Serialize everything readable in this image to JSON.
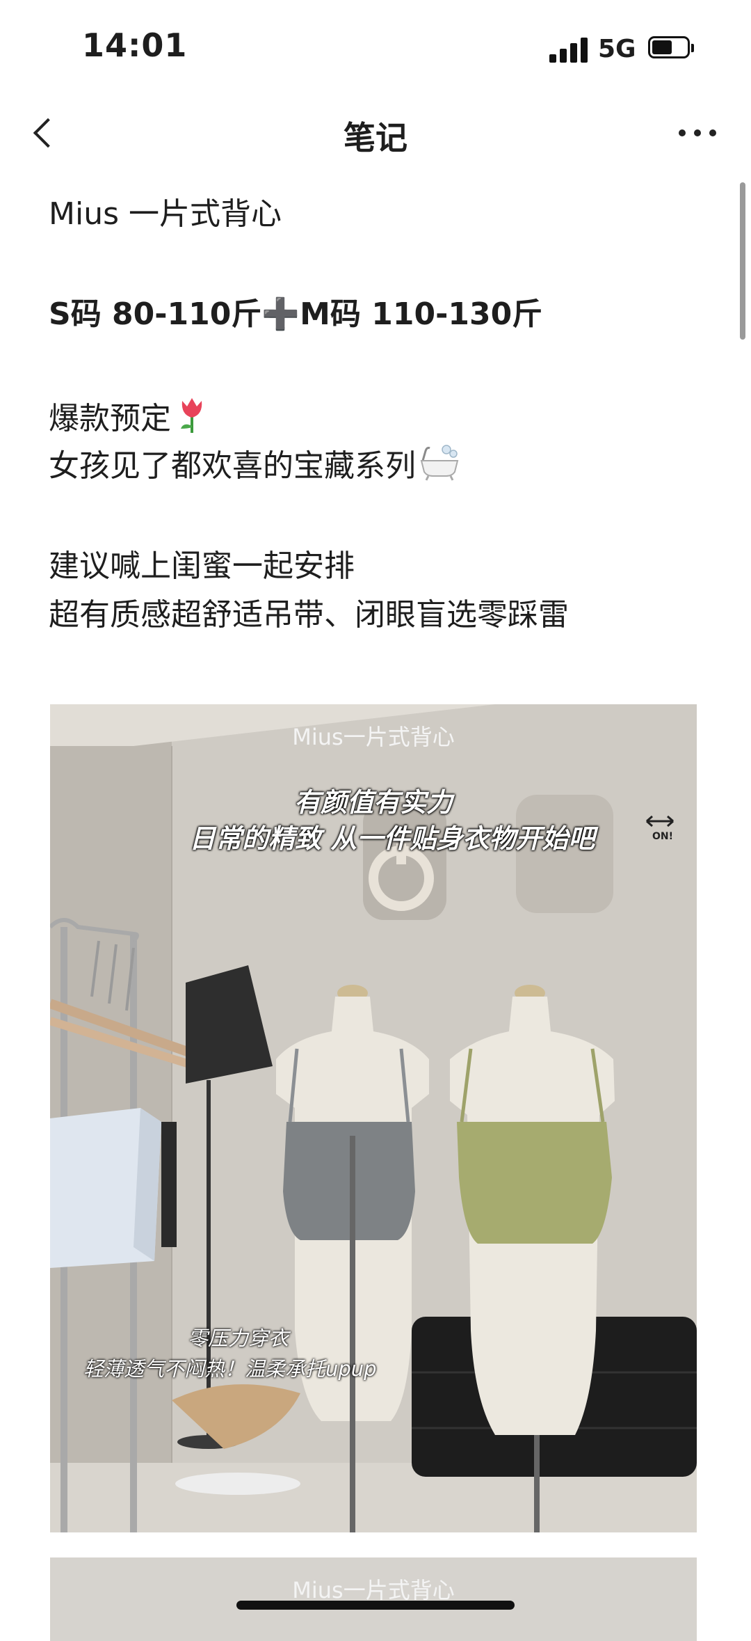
{
  "status": {
    "time": "14:01",
    "network": "5G"
  },
  "nav": {
    "title": "笔记"
  },
  "note": {
    "lines": [
      "Mius 一片式背心",
      "S码 80-110斤➕M码 110-130斤",
      "爆款预定",
      "女孩见了都欢喜的宝藏系列",
      "建议喊上闺蜜一起安排",
      "超有质感超舒适吊带、闭眼盲选零踩雷"
    ]
  },
  "photo1": {
    "caption": "Mius一片式背心",
    "overlay_title": "有颜值有实力",
    "overlay_sub": "日常的精致 从一件贴身衣物开始吧",
    "overlay_small1": "零压力穿衣",
    "overlay_small2": "轻薄透气不闷热！温柔承托upup",
    "on_label": "ON!",
    "colors": {
      "top_gray": "#7e8285",
      "top_green": "#a6ab6f",
      "wall": "#cfcbc4"
    }
  },
  "photo2": {
    "caption": "Mius一片式背心"
  },
  "icons": [
    "signal-icon",
    "battery-icon",
    "back-icon",
    "more-icon",
    "tulip-icon",
    "bathtub-icon",
    "arrows-icon"
  ]
}
